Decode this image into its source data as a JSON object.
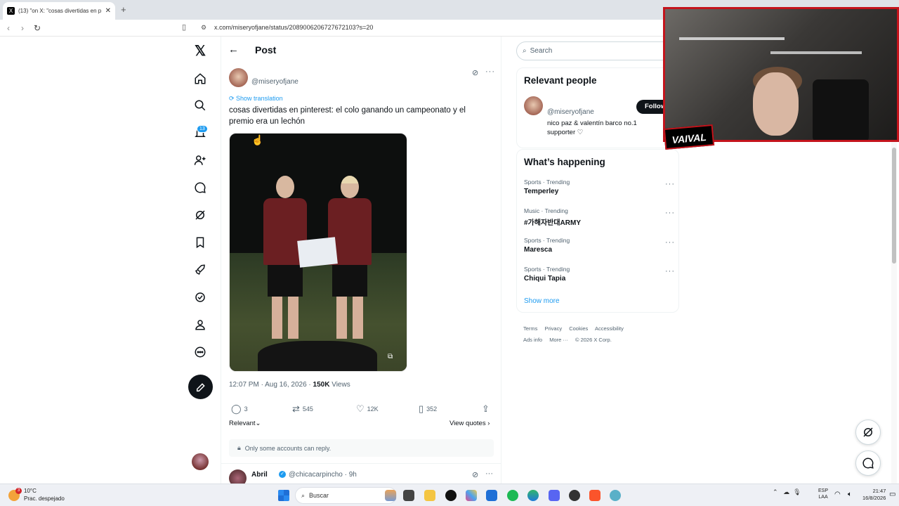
{
  "browser": {
    "tab_title": "(13) \"on X: \"cosas divertidas en p",
    "new_tab": "+",
    "url": "x.com/miseryofjane/status/2089006206727672103?s=20"
  },
  "nav": {
    "notification_count": "13"
  },
  "post": {
    "header": "Post",
    "author_handle": "@miseryofjane",
    "show_translation": "Show translation",
    "text": "cosas divertidas en pinterest: el colo ganando un campeonato y el premio era un lechón",
    "timestamp": "12:07 PM · Aug 16, 2026 · ",
    "views_count": "150K",
    "views_label": " Views",
    "replies": "3",
    "reposts": "545",
    "likes": "12K",
    "bookmarks": "352",
    "sort_label": "Relevant",
    "view_quotes": "View quotes",
    "reply_restriction": "Only some accounts can reply."
  },
  "reply": {
    "name": "Abril",
    "handle": "@chicacarpincho · 9h"
  },
  "sidebar": {
    "search_placeholder": "Search",
    "relevant_people_title": "Relevant people",
    "person_handle": "@miseryofjane",
    "person_bio": "nico paz & valentín barco no.1 supporter ♡",
    "follow_label": "Follow",
    "whats_happening_title": "What’s happening",
    "trends": [
      {
        "category": "Sports · Trending",
        "name": "Temperley"
      },
      {
        "category": "Music · Trending",
        "name": "#가해자반대ARMY"
      },
      {
        "category": "Sports · Trending",
        "name": "Maresca"
      },
      {
        "category": "Sports · Trending",
        "name": "Chiqui Tapia"
      }
    ],
    "show_more": "Show more",
    "footer": [
      "Terms",
      "Privacy",
      "Cookies",
      "Accessibility",
      "Ads info",
      "More ···",
      "© 2026 X Corp."
    ]
  },
  "webcam": {
    "label": "VAIVAL"
  },
  "taskbar": {
    "weather_badge": "3",
    "temperature": "10°C",
    "condition": "Prac. despejado",
    "search_label": "Buscar",
    "lang_line1": "ESP",
    "lang_line2": "LAA",
    "time": "21:47",
    "date": "16/8/2026"
  },
  "colors": {
    "accent": "#1d9bf0",
    "text": "#0f1419",
    "muted": "#536471",
    "webcam_border": "#c4141c"
  }
}
